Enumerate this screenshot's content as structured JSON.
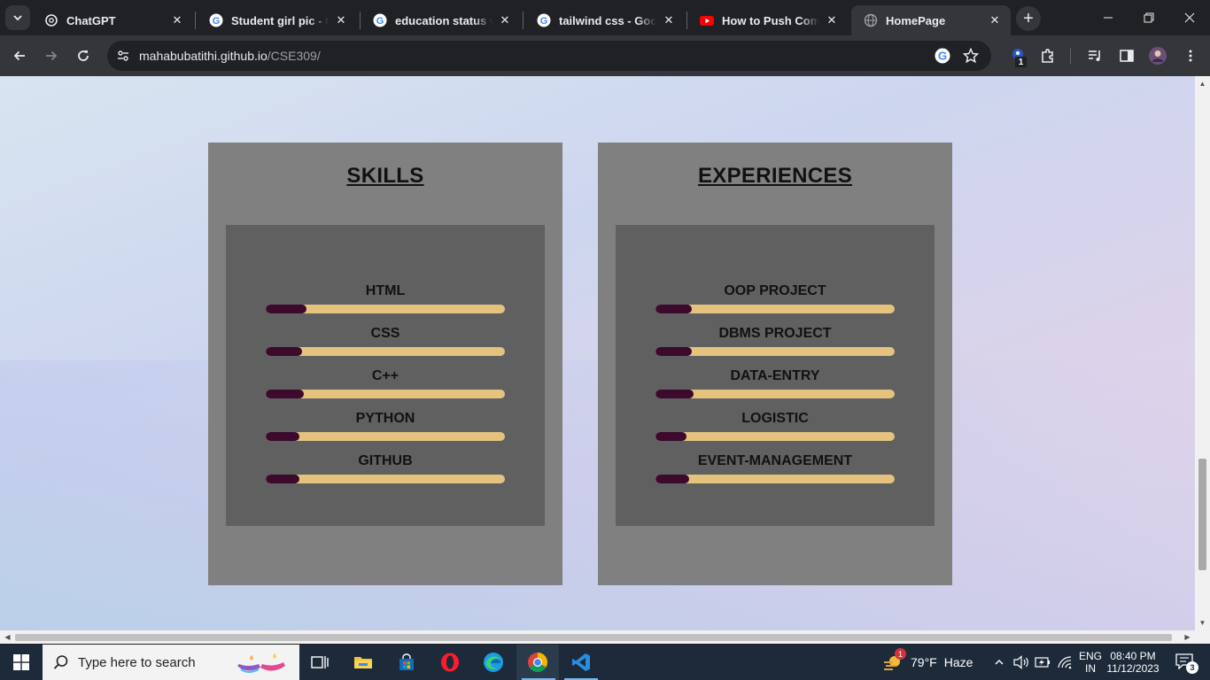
{
  "browser": {
    "tabs": [
      {
        "title": "ChatGPT",
        "icon": "chatgpt-icon",
        "active": false
      },
      {
        "title": "Student girl pic - Goo",
        "icon": "google-icon",
        "active": false
      },
      {
        "title": "education status web",
        "icon": "google-icon",
        "active": false
      },
      {
        "title": "tailwind css - Google",
        "icon": "google-icon",
        "active": false
      },
      {
        "title": "How to Push Comple",
        "icon": "youtube-icon",
        "active": false
      },
      {
        "title": "HomePage",
        "icon": "globe-icon",
        "active": true
      }
    ],
    "url_host": "mahabubatithi.github.io",
    "url_path": "/CSE309/",
    "extensions_badge": "1"
  },
  "page": {
    "skills": {
      "heading": "SKILLS",
      "items": [
        {
          "label": "HTML",
          "level": 0.17
        },
        {
          "label": "CSS",
          "level": 0.15
        },
        {
          "label": "C++",
          "level": 0.16
        },
        {
          "label": "PYTHON",
          "level": 0.14
        },
        {
          "label": "GITHUB",
          "level": 0.14
        }
      ]
    },
    "experiences": {
      "heading": "EXPERIENCES",
      "items": [
        {
          "label": "OOP PROJECT",
          "level": 0.15
        },
        {
          "label": "DBMS PROJECT",
          "level": 0.15
        },
        {
          "label": "DATA-ENTRY",
          "level": 0.16
        },
        {
          "label": "LOGISTIC",
          "level": 0.13
        },
        {
          "label": "EVENT-MANAGEMENT",
          "level": 0.14
        }
      ]
    },
    "colors": {
      "bar_track": "#e3c37e",
      "bar_fill": "#3b0a2c",
      "card": "#808080",
      "inner": "#606060"
    }
  },
  "taskbar": {
    "search_placeholder": "Type here to search",
    "weather_temp": "79°F",
    "weather_desc": "Haze",
    "weather_badge": "1",
    "lang": "ENG",
    "region": "IN",
    "time": "08:40 PM",
    "date": "11/12/2023",
    "notifications": "3"
  }
}
